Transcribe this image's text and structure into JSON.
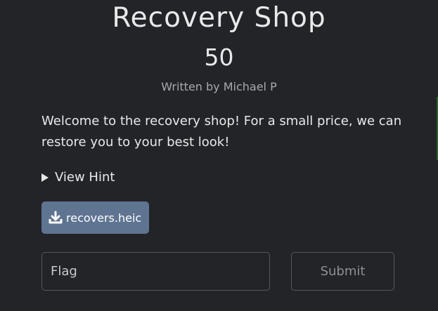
{
  "challenge": {
    "title": "Recovery Shop",
    "points": "50",
    "author": "Written by Michael P",
    "description": "Welcome to the recovery shop! For a small price, we can restore you to your best look!",
    "hint_label": "View Hint",
    "file_name": "recovers.heic"
  },
  "form": {
    "flag_placeholder": "Flag",
    "submit_label": "Submit"
  },
  "icons": {
    "hint_toggle": "triangle-right-icon",
    "file_button": "download-icon"
  },
  "colors": {
    "background": "#222428",
    "text": "#e8e9ea",
    "muted_text": "#a7a9ac",
    "file_button": "#5f7491",
    "input_border": "#55575b"
  }
}
